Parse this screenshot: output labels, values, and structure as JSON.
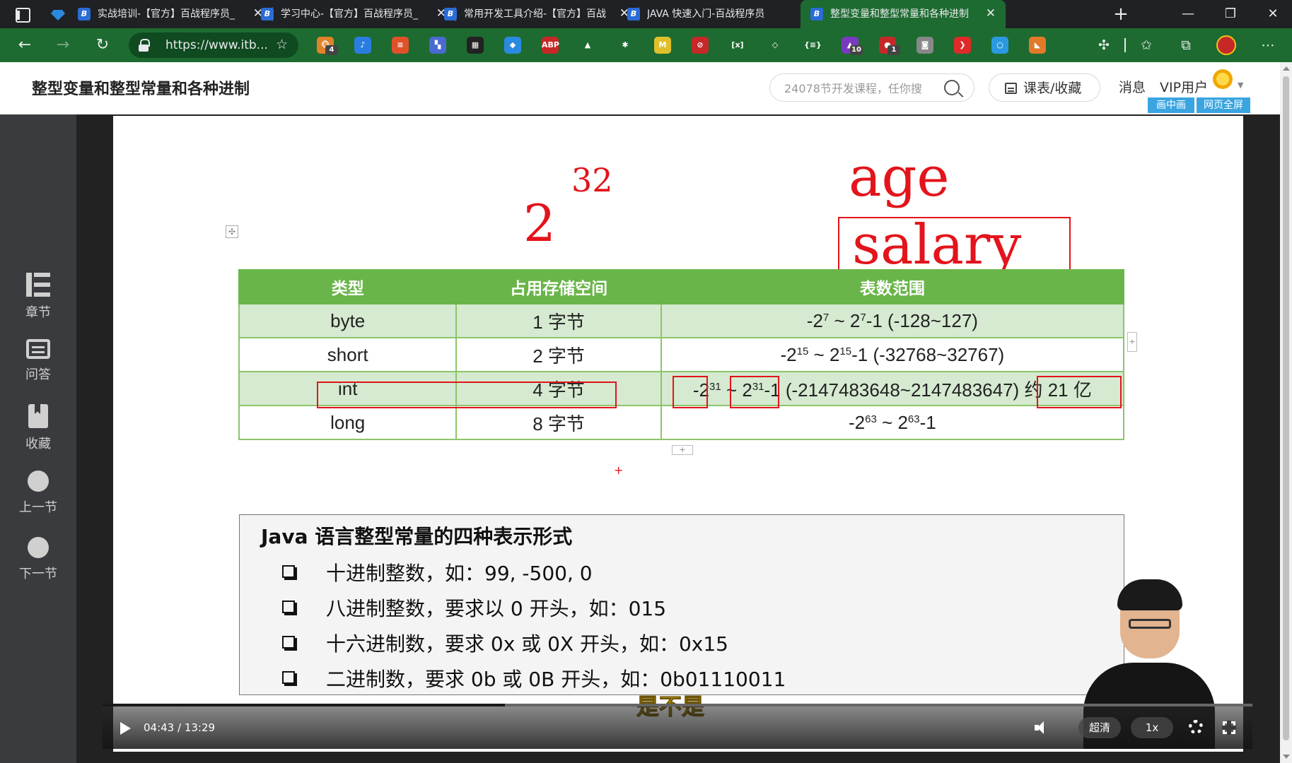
{
  "browser": {
    "tabs": [
      {
        "title": "实战培训-【官方】百战程序员_",
        "active": false
      },
      {
        "title": "学习中心-【官方】百战程序员_",
        "active": false
      },
      {
        "title": "常用开发工具介绍-【官方】百战",
        "active": false
      },
      {
        "title": "JAVA 快速入门-百战程序员",
        "active": false
      },
      {
        "title": "整型变量和整型常量和各种进制",
        "active": true
      }
    ],
    "close_glyph": "✕",
    "new_tab_glyph": "+",
    "address": "https://www.itb...",
    "extensions": [
      {
        "name": "ext-monkey",
        "color": "#e0822a",
        "glyph": "🐵",
        "badge": "4"
      },
      {
        "name": "ext-tiktok",
        "color": "#2a7de0",
        "glyph": "♪",
        "badge": ""
      },
      {
        "name": "ext-orange",
        "color": "#e0512a",
        "glyph": "≡",
        "badge": ""
      },
      {
        "name": "ext-grid",
        "color": "#4a6ad0",
        "glyph": "▚",
        "badge": ""
      },
      {
        "name": "ext-calc",
        "color": "#222222",
        "glyph": "▦",
        "badge": ""
      },
      {
        "name": "ext-gem",
        "color": "#2a8ae0",
        "glyph": "◆",
        "badge": ""
      },
      {
        "name": "ext-abp",
        "color": "#c62828",
        "glyph": "ABP",
        "badge": ""
      },
      {
        "name": "ext-mountain",
        "color": "#1d6b30",
        "glyph": "▲",
        "badge": ""
      },
      {
        "name": "ext-asterisk",
        "color": "#1d6b30",
        "glyph": "✱",
        "badge": ""
      },
      {
        "name": "ext-m",
        "color": "#e0c02a",
        "glyph": "M",
        "badge": ""
      },
      {
        "name": "ext-block",
        "color": "#c62828",
        "glyph": "⊘",
        "badge": ""
      },
      {
        "name": "ext-x",
        "color": "#1d6b30",
        "glyph": "[x]",
        "badge": ""
      },
      {
        "name": "ext-diamond",
        "color": "#1d6b30",
        "glyph": "◇",
        "badge": ""
      },
      {
        "name": "ext-braces",
        "color": "#1d6b30",
        "glyph": "{≡}",
        "badge": ""
      },
      {
        "name": "ext-hat",
        "color": "#7a3ac0",
        "glyph": "▲",
        "badge": "10"
      },
      {
        "name": "ext-mushroom",
        "color": "#c62828",
        "glyph": "●",
        "badge": "1"
      },
      {
        "name": "ext-camera",
        "color": "#888888",
        "glyph": "◙",
        "badge": ""
      },
      {
        "name": "ext-red-c",
        "color": "#e02a2a",
        "glyph": "❯",
        "badge": ""
      },
      {
        "name": "ext-ring",
        "color": "#2a9ae0",
        "glyph": "○",
        "badge": ""
      },
      {
        "name": "ext-fox",
        "color": "#e07a2a",
        "glyph": "◣",
        "badge": ""
      }
    ]
  },
  "header": {
    "title": "整型变量和整型常量和各种进制",
    "search_placeholder": "24078节开发课程，任你搜",
    "course_button": "课表/收藏",
    "messages": "消息",
    "vip": "VIP用户",
    "pip_button": "画中画",
    "fullscreen_button": "网页全屏"
  },
  "sidebar": {
    "items": [
      {
        "label": "章节",
        "icon": "list-icon"
      },
      {
        "label": "问答",
        "icon": "chat-icon"
      },
      {
        "label": "收藏",
        "icon": "bookmark-icon"
      },
      {
        "label": "上一节",
        "icon": "prev-icon"
      },
      {
        "label": "下一节",
        "icon": "next-icon"
      }
    ]
  },
  "slide": {
    "handwriting": {
      "power_exponent": "32",
      "power_base": "2",
      "word1": "age",
      "word2": "salary"
    },
    "table": {
      "headers": [
        "类型",
        "占用存储空间",
        "表数范围"
      ],
      "rows": [
        {
          "type": "byte",
          "size": "1 字节",
          "range": "-2^7 ~ 2^7-1 (-128~127)"
        },
        {
          "type": "short",
          "size": "2 字节",
          "range": "-2^15 ~ 2^15-1 (-32768~32767)"
        },
        {
          "type": "int",
          "size": "4 字节",
          "range": "-2^31 ~ 2^31-1 (-2147483648~2147483647)",
          "note": "约 21 亿"
        },
        {
          "type": "long",
          "size": "8 字节",
          "range": "-2^63 ~ 2^63-1"
        }
      ]
    },
    "java_box": {
      "title": "Java 语言整型常量的四种表示形式",
      "items": [
        "十进制整数，如：99, -500, 0",
        "八进制整数，要求以 0 开头，如：015",
        "十六进制数，要求 0x 或 0X 开头，如：0x15",
        "二进制数，要求 0b 或 0B 开头，如：0b01110011"
      ]
    }
  },
  "player": {
    "current_time": "04:43",
    "total_time": "13:29",
    "time_text": "04:43 / 13:29",
    "progress_fraction": 0.35,
    "quality": "超清",
    "speed": "1x",
    "subtitle": "是不是"
  }
}
